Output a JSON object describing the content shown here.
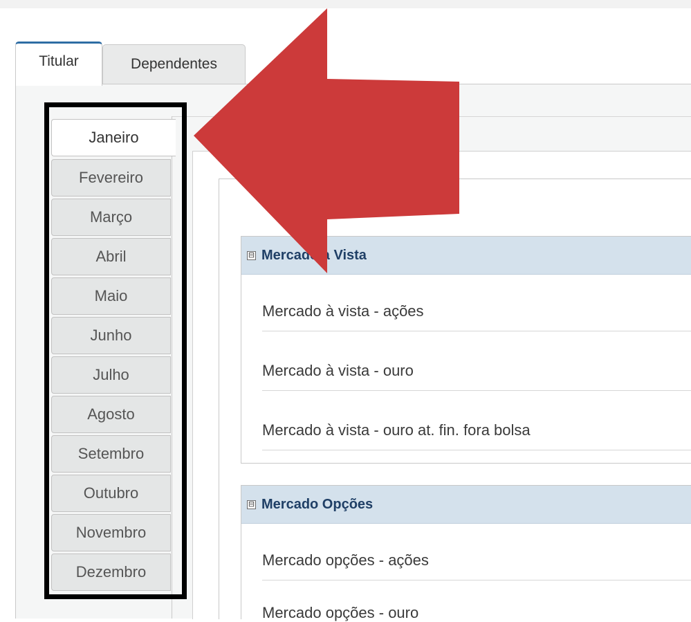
{
  "tabs": {
    "titular": "Titular",
    "dependentes": "Dependentes"
  },
  "months": [
    "Janeiro",
    "Fevereiro",
    "Março",
    "Abril",
    "Maio",
    "Junho",
    "Julho",
    "Agosto",
    "Setembro",
    "Outubro",
    "Novembro",
    "Dezembro"
  ],
  "active_month": "Janeiro",
  "sections": [
    {
      "title": "Mercado à Vista",
      "toggle": "⊟",
      "rows": [
        "Mercado à vista - ações",
        "Mercado à vista - ouro",
        "Mercado à vista - ouro at. fin. fora bolsa"
      ]
    },
    {
      "title": "Mercado Opções",
      "toggle": "⊟",
      "rows": [
        "Mercado opções - ações",
        "Mercado opções - ouro"
      ]
    }
  ],
  "colors": {
    "annotation_arrow": "#cc3a3a",
    "annotation_frame": "#000000",
    "section_header_bg": "#d4e1ec",
    "section_header_text": "#1f3f66"
  }
}
